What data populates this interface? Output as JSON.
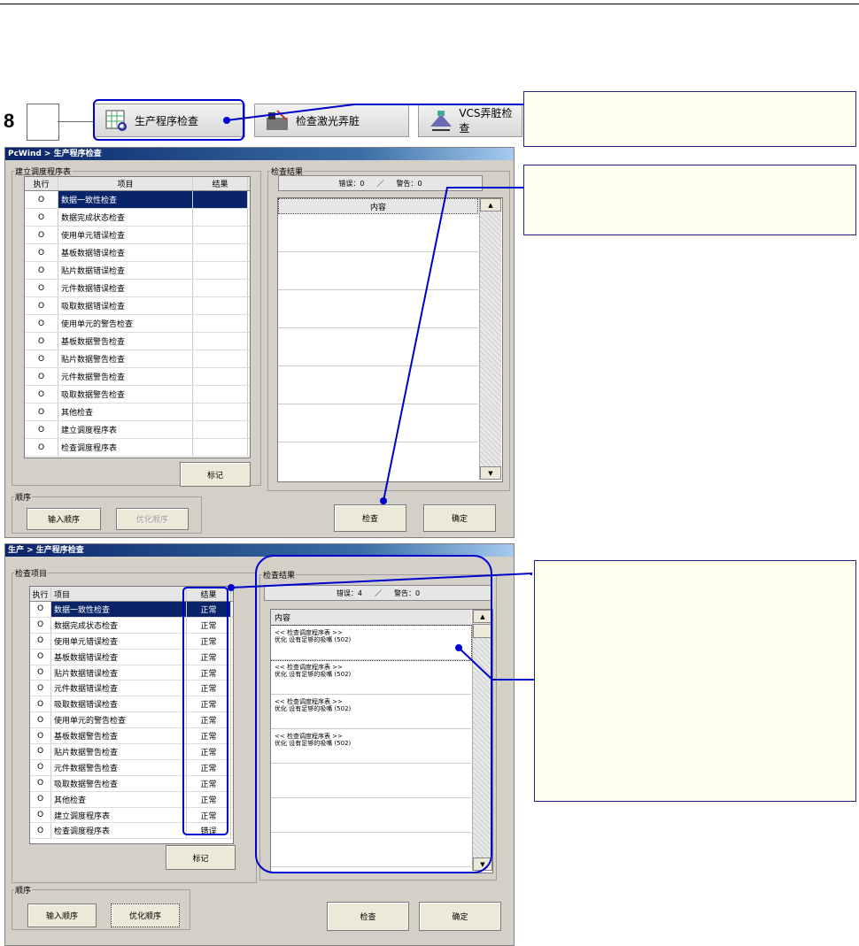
{
  "step": {
    "number": "8"
  },
  "toolbar": {
    "buttons": [
      {
        "label": "生产程序检查",
        "icon": "grid-check-icon"
      },
      {
        "label": "检查激光弄脏",
        "icon": "laser-camera-icon"
      },
      {
        "label": "VCS弄脏检查",
        "icon": "vcs-camera-icon"
      }
    ]
  },
  "window1": {
    "title": "PcWind > 生产程序检查",
    "group_label": "建立调度程序表",
    "columns": {
      "exec": "执行",
      "item": "项目",
      "result": "结果"
    },
    "rows": [
      {
        "exec": "O",
        "item": "数据一致性检查",
        "result": ""
      },
      {
        "exec": "O",
        "item": "数据完成状态检查",
        "result": ""
      },
      {
        "exec": "O",
        "item": "使用单元错误检查",
        "result": ""
      },
      {
        "exec": "O",
        "item": "基板数据错误检查",
        "result": ""
      },
      {
        "exec": "O",
        "item": "贴片数据错误检查",
        "result": ""
      },
      {
        "exec": "O",
        "item": "元件数据错误检查",
        "result": ""
      },
      {
        "exec": "O",
        "item": "吸取数据错误检查",
        "result": ""
      },
      {
        "exec": "O",
        "item": "使用单元的警告检查",
        "result": ""
      },
      {
        "exec": "O",
        "item": "基板数据警告检查",
        "result": ""
      },
      {
        "exec": "O",
        "item": "贴片数据警告检查",
        "result": ""
      },
      {
        "exec": "O",
        "item": "元件数据警告检查",
        "result": ""
      },
      {
        "exec": "O",
        "item": "吸取数据警告检查",
        "result": ""
      },
      {
        "exec": "O",
        "item": "其他检查",
        "result": ""
      },
      {
        "exec": "O",
        "item": "建立调度程序表",
        "result": ""
      },
      {
        "exec": "O",
        "item": "检查调度程序表",
        "result": ""
      }
    ],
    "mark_button": "标记",
    "results_group": "检查结果",
    "summary": {
      "errors": "错误：0",
      "sep": "／",
      "warnings": "警告：0"
    },
    "content_header": "内容",
    "order_group": "顺序",
    "input_order_button": "输入顺序",
    "optimize_order_button": "优化顺序",
    "check_button": "检查",
    "ok_button": "确定"
  },
  "window2": {
    "title": "生产 > 生产程序检查",
    "group_label": "检查项目",
    "columns": {
      "exec": "执行",
      "item": "项目",
      "result": "结果"
    },
    "rows": [
      {
        "exec": "O",
        "item": "数据一致性检查",
        "result": "正常"
      },
      {
        "exec": "O",
        "item": "数据完成状态检查",
        "result": "正常"
      },
      {
        "exec": "O",
        "item": "使用单元错误检查",
        "result": "正常"
      },
      {
        "exec": "O",
        "item": "基板数据错误检查",
        "result": "正常"
      },
      {
        "exec": "O",
        "item": "贴片数据错误检查",
        "result": "正常"
      },
      {
        "exec": "O",
        "item": "元件数据错误检查",
        "result": "正常"
      },
      {
        "exec": "O",
        "item": "吸取数据错误检查",
        "result": "正常"
      },
      {
        "exec": "O",
        "item": "使用单元的警告检查",
        "result": "正常"
      },
      {
        "exec": "O",
        "item": "基板数据警告检查",
        "result": "正常"
      },
      {
        "exec": "O",
        "item": "贴片数据警告检查",
        "result": "正常"
      },
      {
        "exec": "O",
        "item": "元件数据警告检查",
        "result": "正常"
      },
      {
        "exec": "O",
        "item": "吸取数据警告检查",
        "result": "正常"
      },
      {
        "exec": "O",
        "item": "其他检查",
        "result": "正常"
      },
      {
        "exec": "O",
        "item": "建立调度程序表",
        "result": "正常"
      },
      {
        "exec": "O",
        "item": "检查调度程序表",
        "result": "错误"
      }
    ],
    "mark_button": "标记",
    "results_group": "检查结果",
    "summary": {
      "errors": "错误：4",
      "sep": "／",
      "warnings": "警告：0"
    },
    "content_header": "内容",
    "results": [
      {
        "line1": "<< 检查调度程序表 >>",
        "line2": "优化 设有足够的吸嘴 (502)"
      },
      {
        "line1": "<< 检查调度程序表 >>",
        "line2": "优化 设有足够的吸嘴 (502)"
      },
      {
        "line1": "<< 检查调度程序表 >>",
        "line2": "优化 设有足够的吸嘴 (502)"
      },
      {
        "line1": "<< 检查调度程序表 >>",
        "line2": "优化 设有足够的吸嘴 (502)"
      }
    ],
    "order_group": "顺序",
    "input_order_button": "输入顺序",
    "optimize_order_button": "优化顺序",
    "check_button": "检查",
    "ok_button": "确定"
  },
  "colors": {
    "callout": "#0000cc",
    "selection": "#0a246a",
    "note_bg": "#fffff0"
  }
}
